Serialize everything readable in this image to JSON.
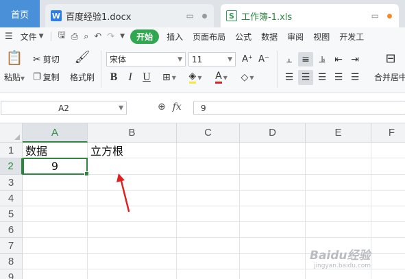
{
  "tabs": {
    "home": "首页",
    "doc": {
      "icon": "W",
      "title": "百度经验1.docx"
    },
    "xls": {
      "icon": "S",
      "title": "工作簿-1.xls"
    }
  },
  "menubar": {
    "file_label": "文件",
    "items": [
      "开始",
      "插入",
      "页面布局",
      "公式",
      "数据",
      "审阅",
      "视图",
      "开发工"
    ]
  },
  "ribbon": {
    "paste": "粘贴",
    "cut": "剪切",
    "copy": "复制",
    "format_painter": "格式刷",
    "font_name": "宋体",
    "font_size": "11",
    "merge_center": "合并居中"
  },
  "formula_bar": {
    "name_box": "A2",
    "fx": "fx",
    "value": "9"
  },
  "sheet": {
    "columns": [
      "A",
      "B",
      "C",
      "D",
      "E",
      "F"
    ],
    "rows": [
      "1",
      "2",
      "3",
      "4",
      "5",
      "6",
      "7",
      "8",
      "9"
    ],
    "cells": {
      "A1": "数据",
      "B1": "立方根",
      "A2": "9"
    }
  },
  "watermark": {
    "text": "Baidu经验",
    "subtext": "jingyan.baidu.com"
  },
  "colors": {
    "accent": "#2e8540",
    "tab_home": "#4a90d9",
    "annotation_arrow": "#e02020"
  }
}
